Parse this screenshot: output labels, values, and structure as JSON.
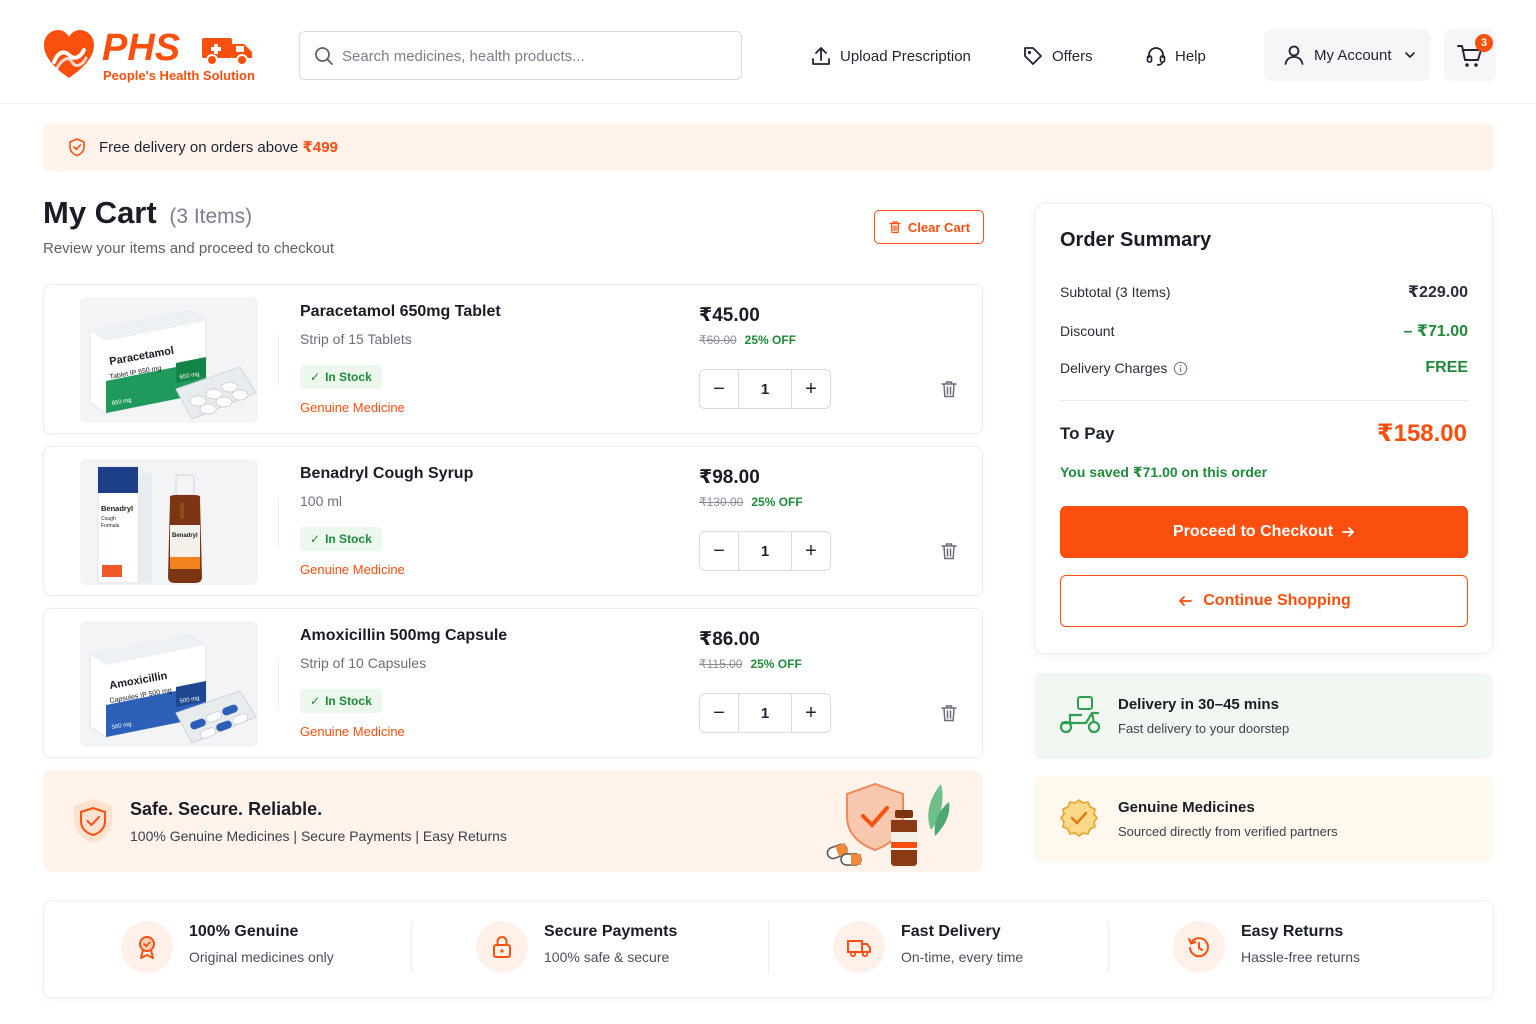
{
  "brand": {
    "name": "PHS",
    "tagline": "People's Health Solution",
    "color": "#fb4f0f"
  },
  "header": {
    "search_placeholder": "Search medicines, health products...",
    "upload": "Upload Prescription",
    "offers": "Offers",
    "help": "Help",
    "account": "My Account",
    "cart_count": "3"
  },
  "banner": {
    "text": "Free delivery on orders above",
    "amount": "₹499"
  },
  "cart": {
    "title": "My Cart",
    "count": "(3 Items)",
    "subtitle": "Review your items and proceed to checkout",
    "clear": "Clear Cart",
    "items": [
      {
        "name": "Paracetamol 650mg Tablet",
        "pack": "Strip of 15 Tablets",
        "stock": "In Stock",
        "genuine": "Genuine Medicine",
        "price": "₹45.00",
        "mrp": "₹60.00",
        "off": "25% OFF",
        "qty": "1"
      },
      {
        "name": "Benadryl Cough Syrup",
        "pack": "100 ml",
        "stock": "In Stock",
        "genuine": "Genuine Medicine",
        "price": "₹98.00",
        "mrp": "₹130.00",
        "off": "25% OFF",
        "qty": "1"
      },
      {
        "name": "Amoxicillin 500mg Capsule",
        "pack": "Strip of 10 Capsules",
        "stock": "In Stock",
        "genuine": "Genuine Medicine",
        "price": "₹86.00",
        "mrp": "₹115.00",
        "off": "25% OFF",
        "qty": "1"
      }
    ]
  },
  "product_art": {
    "paracetamol": {
      "name": "Paracetamol",
      "strength": "Tablet IP 650 mg",
      "badge": "650 mg",
      "side": "650 mg"
    },
    "benadryl": {
      "name": "Benadryl",
      "line2": "Cough",
      "line3": "Formula",
      "bottle": "Benadryl"
    },
    "amoxicillin": {
      "name": "Amoxicillin",
      "strength": "Capsules IP 500 mg",
      "badge": "500 mg",
      "side": "500 mg"
    }
  },
  "safe": {
    "title": "Safe. Secure. Reliable.",
    "subtitle": "100% Genuine Medicines | Secure Payments | Easy Returns"
  },
  "summary": {
    "title": "Order Summary",
    "subtotal_label": "Subtotal (3 Items)",
    "subtotal": "₹229.00",
    "discount_label": "Discount",
    "discount": "– ₹71.00",
    "delivery_label": "Delivery Charges",
    "delivery": "FREE",
    "topay_label": "To Pay",
    "topay": "₹158.00",
    "saved": "You saved ₹71.00 on this order",
    "checkout": "Proceed to Checkout",
    "continue": "Continue Shopping"
  },
  "info": [
    {
      "title": "Delivery in 30–45 mins",
      "sub": "Fast delivery to your doorstep",
      "bg": "#f1f8f2"
    },
    {
      "title": "Genuine Medicines",
      "sub": "Sourced directly from verified partners",
      "bg": "#fff8ee"
    }
  ],
  "features": [
    {
      "title": "100% Genuine",
      "sub": "Original medicines only",
      "icon": "award-icon"
    },
    {
      "title": "Secure Payments",
      "sub": "100% safe & secure",
      "icon": "lock-icon"
    },
    {
      "title": "Fast Delivery",
      "sub": "On-time, every time",
      "icon": "truck-icon"
    },
    {
      "title": "Easy Returns",
      "sub": "Hassle-free returns",
      "icon": "return-icon"
    }
  ]
}
